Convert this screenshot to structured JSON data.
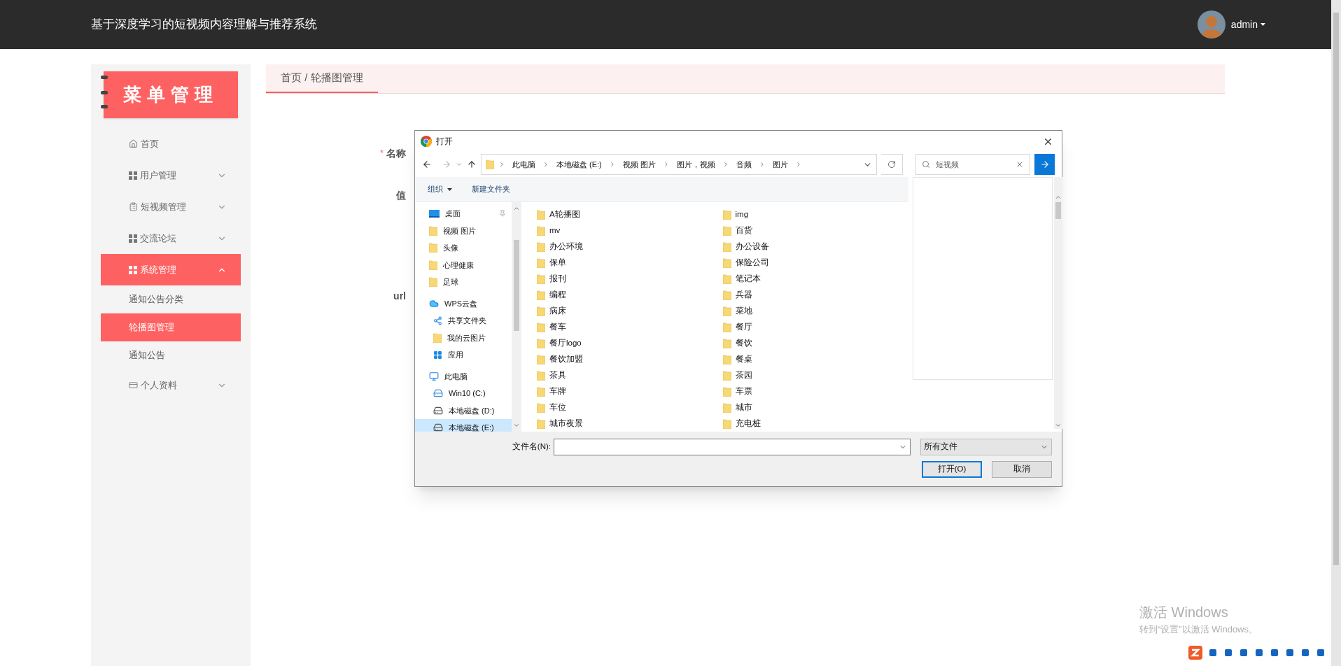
{
  "header": {
    "title": "基于深度学习的短视频内容理解与推荐系统",
    "user": "admin"
  },
  "sidebar": {
    "logo_title": "菜单管理",
    "items": [
      {
        "label": "首页",
        "kind": "home",
        "selected": false
      },
      {
        "label": "用户管理",
        "kind": "grid",
        "selected": false,
        "expanded": false
      },
      {
        "label": "短视频管理",
        "kind": "clipboard",
        "selected": false,
        "expanded": false
      },
      {
        "label": "交流论坛",
        "kind": "grid",
        "selected": false,
        "expanded": false
      },
      {
        "label": "系统管理",
        "kind": "grid",
        "selected": true,
        "expanded": true,
        "children": [
          {
            "label": "通知公告分类",
            "selected": false
          },
          {
            "label": "轮播图管理",
            "selected": true
          },
          {
            "label": "通知公告",
            "selected": false
          }
        ]
      },
      {
        "label": "个人资料",
        "kind": "card",
        "selected": false,
        "expanded": false
      }
    ]
  },
  "breadcrumb": "首页 / 轮播图管理",
  "form_labels": [
    {
      "label": "名称",
      "required_mark": "*"
    },
    {
      "label": "值"
    },
    {
      "label": "url"
    }
  ],
  "dialog": {
    "title": "打开",
    "path": [
      "此电脑",
      "本地磁盘 (E:)",
      "视频 图片",
      "图片，视频",
      "音频",
      "图片"
    ],
    "search_value": "短视频",
    "organize": "组织",
    "new_folder": "新建文件夹",
    "nav": [
      {
        "label": "桌面",
        "kind": "desktop",
        "pinned": true,
        "selected": false
      },
      {
        "label": "视频 图片",
        "kind": "folder",
        "pinned": false,
        "selected": false
      },
      {
        "label": "头像",
        "kind": "folder",
        "pinned": false,
        "selected": false
      },
      {
        "label": "心理健康",
        "kind": "folder",
        "pinned": false,
        "selected": false
      },
      {
        "label": "足球",
        "kind": "folder",
        "pinned": false,
        "selected": false
      },
      {
        "label": "WPS云盘",
        "kind": "cloud",
        "pinned": false,
        "selected": false,
        "children": [
          {
            "label": "共享文件夹",
            "kind": "share",
            "pinned": false,
            "selected": false
          },
          {
            "label": "我的云图片",
            "kind": "folder",
            "pinned": false,
            "selected": false
          },
          {
            "label": "应用",
            "kind": "apps",
            "pinned": false,
            "selected": false
          }
        ]
      },
      {
        "label": "此电脑",
        "kind": "computer",
        "pinned": false,
        "selected": false,
        "children": [
          {
            "label": "Win10 (C:)",
            "kind": "system-drive",
            "pinned": false,
            "selected": false
          },
          {
            "label": "本地磁盘 (D:)",
            "kind": "drive",
            "pinned": false,
            "selected": false
          },
          {
            "label": "本地磁盘 (E:)",
            "kind": "drive",
            "pinned": false,
            "selected": true
          }
        ]
      }
    ],
    "file_columns": [
      [
        "A轮播图",
        "mv",
        "办公环境",
        "保单",
        "报刊",
        "编程",
        "病床",
        "餐车",
        "餐厅logo",
        "餐饮加盟",
        "茶具",
        "车牌",
        "车位",
        "城市夜景"
      ],
      [
        "img",
        "百货",
        "办公设备",
        "保险公司",
        "笔记本",
        "兵器",
        "菜地",
        "餐厅",
        "餐饮",
        "餐桌",
        "茶园",
        "车票",
        "城市",
        "充电桩"
      ]
    ],
    "filename_label": "文件名(N):",
    "filetype": "所有文件",
    "open_button": "打开(O)",
    "cancel_button": "取消"
  },
  "activation": {
    "title": "激活 Windows",
    "subtitle": "转到“设置”以激活 Windows。"
  }
}
